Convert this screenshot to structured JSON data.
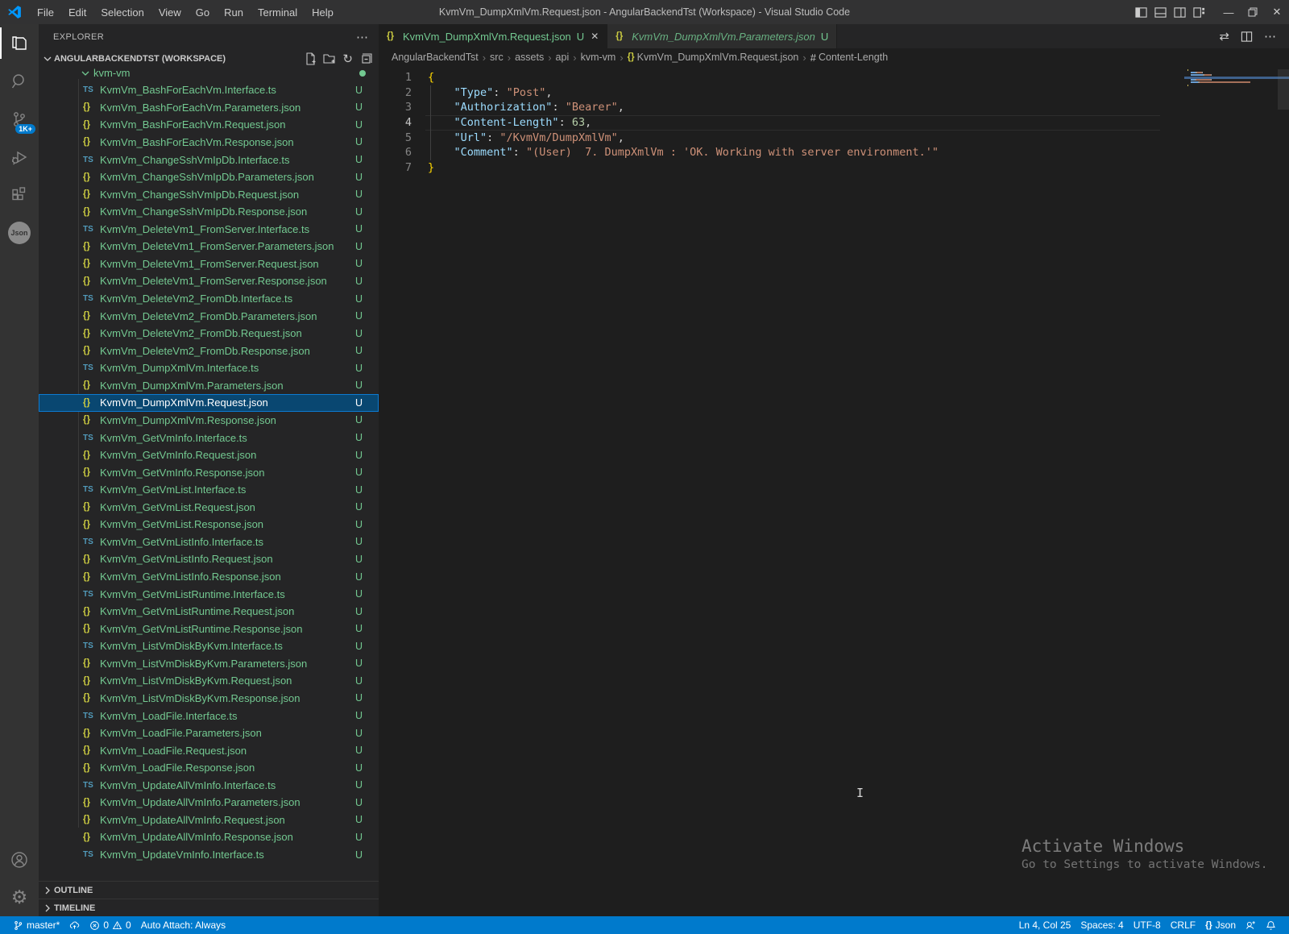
{
  "window": {
    "title": "KvmVm_DumpXmlVm.Request.json - AngularBackendTst (Workspace) - Visual Studio Code",
    "menus": [
      "File",
      "Edit",
      "Selection",
      "View",
      "Go",
      "Run",
      "Terminal",
      "Help"
    ]
  },
  "icons": {
    "minimize": "—",
    "close": "✕",
    "more_dots": "⋯",
    "refresh": "↻",
    "open_changes": "⇄",
    "gear": "⚙",
    "ts_badge": "TS",
    "braces": "{}",
    "hash": "#",
    "ibeam": "I",
    "breadcrumb_sep": "›"
  },
  "activity_bar": {
    "scm_badge": "1K+",
    "json_ext_label": "Json"
  },
  "sidebar": {
    "explorer_title": "EXPLORER",
    "workspace_label": "ANGULARBACKENDTST (WORKSPACE)",
    "folder": {
      "name": "kvm-vm"
    },
    "outline_label": "OUTLINE",
    "timeline_label": "TIMELINE",
    "files": [
      {
        "name": "KvmVm_BashForEachVm.Interface.ts",
        "type": "ts",
        "badge": "U"
      },
      {
        "name": "KvmVm_BashForEachVm.Parameters.json",
        "type": "json",
        "badge": "U"
      },
      {
        "name": "KvmVm_BashForEachVm.Request.json",
        "type": "json",
        "badge": "U"
      },
      {
        "name": "KvmVm_BashForEachVm.Response.json",
        "type": "json",
        "badge": "U"
      },
      {
        "name": "KvmVm_ChangeSshVmIpDb.Interface.ts",
        "type": "ts",
        "badge": "U"
      },
      {
        "name": "KvmVm_ChangeSshVmIpDb.Parameters.json",
        "type": "json",
        "badge": "U"
      },
      {
        "name": "KvmVm_ChangeSshVmIpDb.Request.json",
        "type": "json",
        "badge": "U"
      },
      {
        "name": "KvmVm_ChangeSshVmIpDb.Response.json",
        "type": "json",
        "badge": "U"
      },
      {
        "name": "KvmVm_DeleteVm1_FromServer.Interface.ts",
        "type": "ts",
        "badge": "U"
      },
      {
        "name": "KvmVm_DeleteVm1_FromServer.Parameters.json",
        "type": "json",
        "badge": "U"
      },
      {
        "name": "KvmVm_DeleteVm1_FromServer.Request.json",
        "type": "json",
        "badge": "U"
      },
      {
        "name": "KvmVm_DeleteVm1_FromServer.Response.json",
        "type": "json",
        "badge": "U"
      },
      {
        "name": "KvmVm_DeleteVm2_FromDb.Interface.ts",
        "type": "ts",
        "badge": "U"
      },
      {
        "name": "KvmVm_DeleteVm2_FromDb.Parameters.json",
        "type": "json",
        "badge": "U"
      },
      {
        "name": "KvmVm_DeleteVm2_FromDb.Request.json",
        "type": "json",
        "badge": "U"
      },
      {
        "name": "KvmVm_DeleteVm2_FromDb.Response.json",
        "type": "json",
        "badge": "U"
      },
      {
        "name": "KvmVm_DumpXmlVm.Interface.ts",
        "type": "ts",
        "badge": "U"
      },
      {
        "name": "KvmVm_DumpXmlVm.Parameters.json",
        "type": "json",
        "badge": "U"
      },
      {
        "name": "KvmVm_DumpXmlVm.Request.json",
        "type": "json",
        "badge": "U",
        "selected": true
      },
      {
        "name": "KvmVm_DumpXmlVm.Response.json",
        "type": "json",
        "badge": "U"
      },
      {
        "name": "KvmVm_GetVmInfo.Interface.ts",
        "type": "ts",
        "badge": "U"
      },
      {
        "name": "KvmVm_GetVmInfo.Request.json",
        "type": "json",
        "badge": "U"
      },
      {
        "name": "KvmVm_GetVmInfo.Response.json",
        "type": "json",
        "badge": "U"
      },
      {
        "name": "KvmVm_GetVmList.Interface.ts",
        "type": "ts",
        "badge": "U"
      },
      {
        "name": "KvmVm_GetVmList.Request.json",
        "type": "json",
        "badge": "U"
      },
      {
        "name": "KvmVm_GetVmList.Response.json",
        "type": "json",
        "badge": "U"
      },
      {
        "name": "KvmVm_GetVmListInfo.Interface.ts",
        "type": "ts",
        "badge": "U"
      },
      {
        "name": "KvmVm_GetVmListInfo.Request.json",
        "type": "json",
        "badge": "U"
      },
      {
        "name": "KvmVm_GetVmListInfo.Response.json",
        "type": "json",
        "badge": "U"
      },
      {
        "name": "KvmVm_GetVmListRuntime.Interface.ts",
        "type": "ts",
        "badge": "U"
      },
      {
        "name": "KvmVm_GetVmListRuntime.Request.json",
        "type": "json",
        "badge": "U"
      },
      {
        "name": "KvmVm_GetVmListRuntime.Response.json",
        "type": "json",
        "badge": "U"
      },
      {
        "name": "KvmVm_ListVmDiskByKvm.Interface.ts",
        "type": "ts",
        "badge": "U"
      },
      {
        "name": "KvmVm_ListVmDiskByKvm.Parameters.json",
        "type": "json",
        "badge": "U"
      },
      {
        "name": "KvmVm_ListVmDiskByKvm.Request.json",
        "type": "json",
        "badge": "U"
      },
      {
        "name": "KvmVm_ListVmDiskByKvm.Response.json",
        "type": "json",
        "badge": "U"
      },
      {
        "name": "KvmVm_LoadFile.Interface.ts",
        "type": "ts",
        "badge": "U"
      },
      {
        "name": "KvmVm_LoadFile.Parameters.json",
        "type": "json",
        "badge": "U"
      },
      {
        "name": "KvmVm_LoadFile.Request.json",
        "type": "json",
        "badge": "U"
      },
      {
        "name": "KvmVm_LoadFile.Response.json",
        "type": "json",
        "badge": "U"
      },
      {
        "name": "KvmVm_UpdateAllVmInfo.Interface.ts",
        "type": "ts",
        "badge": "U"
      },
      {
        "name": "KvmVm_UpdateAllVmInfo.Parameters.json",
        "type": "json",
        "badge": "U"
      },
      {
        "name": "KvmVm_UpdateAllVmInfo.Request.json",
        "type": "json",
        "badge": "U"
      },
      {
        "name": "KvmVm_UpdateAllVmInfo.Response.json",
        "type": "json",
        "badge": "U"
      },
      {
        "name": "KvmVm_UpdateVmInfo.Interface.ts",
        "type": "ts",
        "badge": "U"
      }
    ]
  },
  "tabs": [
    {
      "name": "KvmVm_DumpXmlVm.Request.json",
      "dirty": "U",
      "active": true
    },
    {
      "name": "KvmVm_DumpXmlVm.Parameters.json",
      "dirty": "U",
      "active": false
    }
  ],
  "breadcrumb": [
    {
      "label": "AngularBackendTst"
    },
    {
      "label": "src"
    },
    {
      "label": "assets"
    },
    {
      "label": "api"
    },
    {
      "label": "kvm-vm"
    },
    {
      "label": "KvmVm_DumpXmlVm.Request.json",
      "icon": "json-braces"
    },
    {
      "label": "Content-Length",
      "icon": "symbol-hash"
    }
  ],
  "editor": {
    "active_line": 4,
    "lines": [
      {
        "num": 1,
        "tokens": [
          {
            "c": "brace",
            "t": "{"
          }
        ]
      },
      {
        "num": 2,
        "tokens": [
          {
            "c": "ws",
            "t": "    "
          },
          {
            "c": "key",
            "t": "\"Type\""
          },
          {
            "c": "punct",
            "t": ": "
          },
          {
            "c": "str",
            "t": "\"Post\""
          },
          {
            "c": "punct",
            "t": ","
          }
        ]
      },
      {
        "num": 3,
        "tokens": [
          {
            "c": "ws",
            "t": "    "
          },
          {
            "c": "key",
            "t": "\"Authorization\""
          },
          {
            "c": "punct",
            "t": ": "
          },
          {
            "c": "str",
            "t": "\"Bearer\""
          },
          {
            "c": "punct",
            "t": ","
          }
        ]
      },
      {
        "num": 4,
        "tokens": [
          {
            "c": "ws",
            "t": "    "
          },
          {
            "c": "key",
            "t": "\"Content-Length\""
          },
          {
            "c": "punct",
            "t": ": "
          },
          {
            "c": "num",
            "t": "63"
          },
          {
            "c": "punct",
            "t": ","
          }
        ]
      },
      {
        "num": 5,
        "tokens": [
          {
            "c": "ws",
            "t": "    "
          },
          {
            "c": "key",
            "t": "\"Url\""
          },
          {
            "c": "punct",
            "t": ": "
          },
          {
            "c": "str",
            "t": "\"/KvmVm/DumpXmlVm\""
          },
          {
            "c": "punct",
            "t": ","
          }
        ]
      },
      {
        "num": 6,
        "tokens": [
          {
            "c": "ws",
            "t": "    "
          },
          {
            "c": "key",
            "t": "\"Comment\""
          },
          {
            "c": "punct",
            "t": ": "
          },
          {
            "c": "str",
            "t": "\"(User)  7. DumpXmlVm : 'OK. Working with server environment.'\""
          }
        ]
      },
      {
        "num": 7,
        "tokens": [
          {
            "c": "brace",
            "t": "}"
          }
        ]
      }
    ]
  },
  "status_bar": {
    "branch": "master*",
    "errors": "0",
    "warnings": "0",
    "auto_attach": "Auto Attach: Always",
    "line_col": "Ln 4, Col 25",
    "spaces": "Spaces: 4",
    "encoding": "UTF-8",
    "eol": "CRLF",
    "language": "Json"
  },
  "watermark": {
    "title": "Activate Windows",
    "subtitle": "Go to Settings to activate Windows."
  },
  "colors": {
    "accent": "#007acc",
    "untracked_green": "#73c991",
    "selection": "#094771",
    "editor_bg": "#1e1e1e"
  }
}
